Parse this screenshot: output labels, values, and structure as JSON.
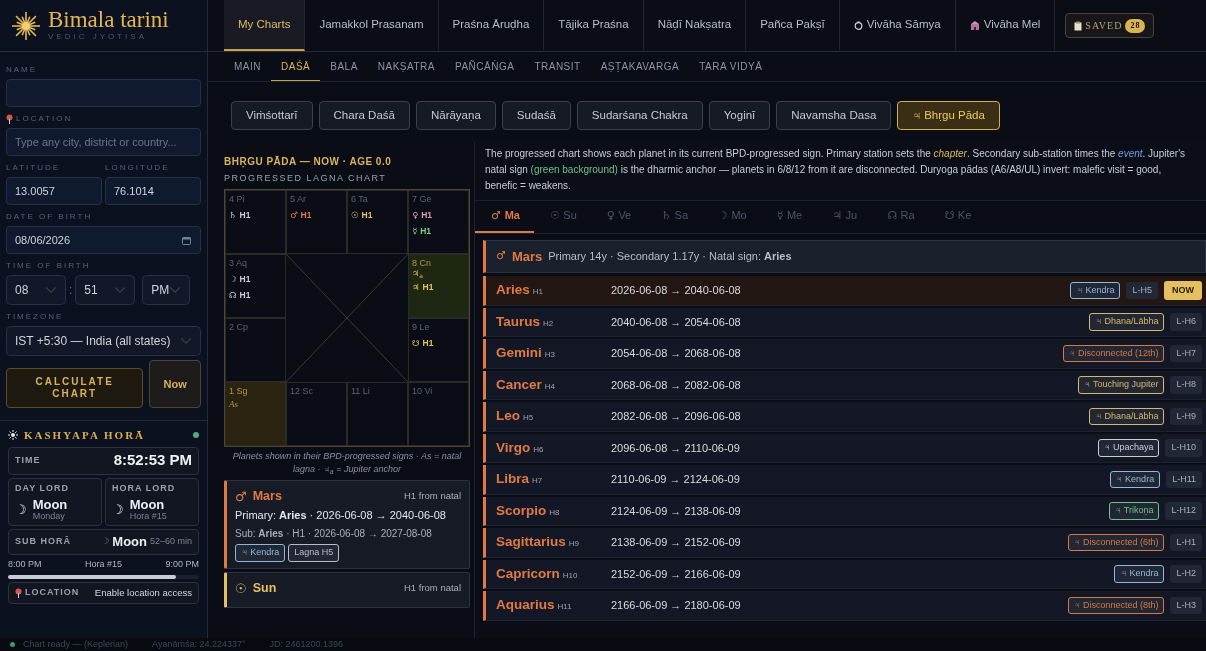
{
  "brand": {
    "name": "Bimala tarini",
    "tagline": "VEDIC JYOTISA"
  },
  "form": {
    "name": {
      "label": "NAME"
    },
    "location": {
      "label": "LOCATION",
      "placeholder": "Type any city, district or country..."
    },
    "latitude": {
      "label": "LATITUDE",
      "value": "13.0057"
    },
    "longitude": {
      "label": "LONGITUDE",
      "value": "76.1014"
    },
    "dob": {
      "label": "DATE OF BIRTH",
      "value": "08/06/2026"
    },
    "tob": {
      "label": "TIME OF BIRTH",
      "hour": "08",
      "separator": ":",
      "minute": "51",
      "ampm": "PM"
    },
    "timezone": {
      "label": "TIMEZONE",
      "value": "IST +5:30 — India (all states)"
    },
    "calculate_button": "CALCULATE CHART",
    "now_button": "Now"
  },
  "hora": {
    "title": "KASHYAPA HORĀ",
    "live": true,
    "time_label": "TIME",
    "time": "8:52:53 PM",
    "day_lord": {
      "label": "DAY LORD",
      "glyph": "☽",
      "name": "Moon",
      "sub": "Monday"
    },
    "hora_lord": {
      "label": "HORA LORD",
      "glyph": "☽",
      "name": "Moon",
      "sub": "Hora #15"
    },
    "sub_hora": {
      "label": "SUB HORĀ",
      "glyph": "☽",
      "name": "Moon",
      "range": "52–60 min"
    },
    "progress": {
      "start": "8:00 PM",
      "label": "Hora #15",
      "end": "9:00 PM",
      "level": 0.88
    },
    "location": {
      "label": "LOCATION",
      "action": "Enable location access"
    }
  },
  "top_nav": [
    {
      "label": "My Charts",
      "kind": "plain",
      "selected": true
    },
    {
      "label": "Jamakkol Prasanam",
      "kind": "plain",
      "selected": false
    },
    {
      "label": "Praśna Āruḍha",
      "kind": "plain",
      "selected": false
    },
    {
      "label": "Tājika Praśna",
      "kind": "plain",
      "selected": false
    },
    {
      "label": "Nāḍī Nakṣatra",
      "kind": "plain",
      "selected": false
    },
    {
      "label": "Pañca Pakṣī",
      "kind": "plain",
      "selected": false
    },
    {
      "label": "Vivāha Sāmya",
      "kind": "ring",
      "selected": false
    },
    {
      "label": "Vivāha Mel",
      "kind": "building",
      "selected": false
    }
  ],
  "saved": {
    "label": "SAVED",
    "count": "28"
  },
  "sub_nav": [
    {
      "label": "MAIN",
      "selected": false
    },
    {
      "label": "DAŚĀ",
      "selected": true
    },
    {
      "label": "BALA",
      "selected": false
    },
    {
      "label": "NAKṢATRA",
      "selected": false
    },
    {
      "label": "PAÑCĀṄGA",
      "selected": false
    },
    {
      "label": "TRANSIT",
      "selected": false
    },
    {
      "label": "AṢṬAKAVARGA",
      "selected": false
    },
    {
      "label": "TARA VIDYĀ",
      "selected": false
    }
  ],
  "dasha_systems": [
    {
      "label": "Viṁśottarī",
      "selected": false
    },
    {
      "label": "Chara Daśā",
      "selected": false
    },
    {
      "label": "Nārāyaṇa",
      "selected": false
    },
    {
      "label": "Sudaśā",
      "selected": false
    },
    {
      "label": "Sudarśana Chakra",
      "selected": false
    },
    {
      "label": "Yoginī",
      "selected": false
    },
    {
      "label": "Navamsha Dasa",
      "selected": false
    },
    {
      "label": "♃ Bhṛgu Pāda",
      "selected": true
    }
  ],
  "chart": {
    "heading": "BHṚGU PĀDA — NOW · AGE 0.0",
    "subheading": "PROGRESSED LAGNA CHART",
    "cells": [
      {
        "label": "4 Pi",
        "kind": "house",
        "planets": [
          {
            "glyph": "♄",
            "text": "H1",
            "color": "#c9ccd6"
          }
        ]
      },
      {
        "label": "5 Ar",
        "kind": "house",
        "planets": [
          {
            "glyph": "♂",
            "text": "H1",
            "color": "#e07a45"
          }
        ]
      },
      {
        "label": "6 Ta",
        "kind": "house",
        "planets": [
          {
            "glyph": "☉",
            "text": "H1",
            "color": "#e3c062"
          }
        ]
      },
      {
        "label": "7 Ge",
        "kind": "house",
        "planets": [
          {
            "glyph": "♀",
            "text": "H1",
            "color": "#e49ab0"
          },
          {
            "glyph": "☿",
            "text": "H1",
            "color": "#7fcf8f"
          }
        ]
      },
      {
        "label": "3 Aq",
        "kind": "house",
        "planets": [
          {
            "glyph": "☽",
            "text": "H1",
            "color": "#c9ccd6"
          },
          {
            "glyph": "☊",
            "text": "H1",
            "color": "#c9ccd6"
          }
        ]
      },
      {
        "label": "8 Cn",
        "kind": "anchor",
        "anchor_mark": "♃$_{a}$",
        "planets": [
          {
            "glyph": "♃",
            "text": "H1",
            "color": "#e3c062"
          }
        ]
      },
      {
        "label": "2 Cp",
        "kind": "house"
      },
      {
        "label": "9 Le",
        "kind": "house",
        "planets": [
          {
            "glyph": "☋",
            "text": "H1",
            "color": "#e3c062"
          }
        ]
      },
      {
        "label": "1 Sg",
        "kind": "lagna",
        "note": "As"
      },
      {
        "label": "12 Sc",
        "kind": "house"
      },
      {
        "label": "11 Li",
        "kind": "house"
      },
      {
        "label": "10 Vi",
        "kind": "house"
      }
    ],
    "footnote": "Planets shown in their BPD-progressed signs · As = natal lagna · ♃$_{a}$ = Jupiter anchor"
  },
  "planet_cards": [
    {
      "glyph": "♂",
      "name": "Mars",
      "color": "#e07a45",
      "position": "H1 from natal",
      "primary": "Primary: **Aries** · 2026-06-08 → 2040-06-08",
      "sub": "Sub: **Aries** · H1 · 2026-06-08 → 2027-08-08",
      "tags": [
        {
          "text": "♃ Kendra",
          "color": "#8fb8dc"
        },
        {
          "text": "Lagna H5",
          "color": "#b9bdc8"
        }
      ]
    },
    {
      "glyph": "☉",
      "name": "Sun",
      "color": "#e3c062",
      "position": "H1 from natal"
    }
  ],
  "description": [
    {
      "kind": "plain",
      "text": "The progressed chart shows each planet in its current BPD-progressed sign. Primary station sets the "
    },
    {
      "kind": "chapter",
      "text": "chapter"
    },
    {
      "kind": "plain",
      "text": ". Secondary sub-station times the "
    },
    {
      "kind": "event",
      "text": "event"
    },
    {
      "kind": "plain",
      "text": ". Jupiter's natal sign "
    },
    {
      "kind": "green",
      "text": "(green background)"
    },
    {
      "kind": "plain",
      "text": " is the dharmic anchor — planets in 6/8/12 from it are disconnected. Duryoga pādas (A6/A8/UL) invert: malefic visit = good, benefic = weakens."
    }
  ],
  "planet_tabs": [
    {
      "glyph": "♂",
      "label": "Ma",
      "selected": true
    },
    {
      "glyph": "☉",
      "label": "Su",
      "selected": false
    },
    {
      "glyph": "♀",
      "label": "Ve",
      "selected": false
    },
    {
      "glyph": "♄",
      "label": "Sa",
      "selected": false
    },
    {
      "glyph": "☽",
      "label": "Mo",
      "selected": false
    },
    {
      "glyph": "☿",
      "label": "Me",
      "selected": false
    },
    {
      "glyph": "♃",
      "label": "Ju",
      "selected": false
    },
    {
      "glyph": "☊",
      "label": "Ra",
      "selected": false
    },
    {
      "glyph": "☋",
      "label": "Ke",
      "selected": false
    }
  ],
  "dasha": {
    "glyph": "♂",
    "name": "Mars",
    "color": "#e07a45",
    "summary": "Primary 14y · Secondary 1.17y · Natal sign: **Aries**",
    "rows": [
      {
        "sign": "Aries",
        "house": "H1",
        "range": "2026-06-08 → 2040-06-08",
        "tag": {
          "text": "♃ Kendra",
          "color": "#8fb8dc"
        },
        "lord": "L-H5",
        "current": true,
        "badge": "NOW"
      },
      {
        "sign": "Taurus",
        "house": "H2",
        "range": "2040-06-08 → 2054-06-08",
        "tag": {
          "text": "♃ Dhana/Lābha",
          "color": "#d8b860"
        },
        "lord": "L-H6",
        "current": false
      },
      {
        "sign": "Gemini",
        "house": "H3",
        "range": "2054-06-08 → 2068-06-08",
        "tag": {
          "text": "♃ Disconnected (12th)",
          "color": "#d9773f"
        },
        "lord": "L-H7",
        "current": false
      },
      {
        "sign": "Cancer",
        "house": "H4",
        "range": "2068-06-08 → 2082-06-08",
        "tag": {
          "text": "♃ Touching Jupiter",
          "color": "#d8b860"
        },
        "lord": "L-H8",
        "current": false
      },
      {
        "sign": "Leo",
        "house": "H5",
        "range": "2082-06-08 → 2096-06-08",
        "tag": {
          "text": "♃ Dhana/Lābha",
          "color": "#d8b860"
        },
        "lord": "L-H9",
        "current": false
      },
      {
        "sign": "Virgo",
        "house": "H6",
        "range": "2096-06-08 → 2110-06-09",
        "tag": {
          "text": "♃ Upachaya",
          "color": "#c9cdd8"
        },
        "lord": "L-H10",
        "current": false
      },
      {
        "sign": "Libra",
        "house": "H7",
        "range": "2110-06-09 → 2124-06-09",
        "tag": {
          "text": "♃ Kendra",
          "color": "#8fb8dc"
        },
        "lord": "L-H11",
        "current": false
      },
      {
        "sign": "Scorpio",
        "house": "H8",
        "range": "2124-06-09 → 2138-06-09",
        "tag": {
          "text": "♃ Trikoṇa",
          "color": "#6fbf8a"
        },
        "lord": "L-H12",
        "current": false
      },
      {
        "sign": "Sagittarius",
        "house": "H9",
        "range": "2138-06-09 → 2152-06-09",
        "tag": {
          "text": "♃ Disconnected (6th)",
          "color": "#d9773f"
        },
        "lord": "L-H1",
        "current": false
      },
      {
        "sign": "Capricorn",
        "house": "H10",
        "range": "2152-06-09 → 2166-06-09",
        "tag": {
          "text": "♃ Kendra",
          "color": "#8fb8dc"
        },
        "lord": "L-H2",
        "current": false
      },
      {
        "sign": "Aquarius",
        "house": "H11",
        "range": "2166-06-09 → 2180-06-09",
        "tag": {
          "text": "♃ Disconnected (8th)",
          "color": "#d9773f"
        },
        "lord": "L-H3",
        "current": false
      }
    ]
  },
  "status_bar": {
    "ready": true,
    "text": "Chart ready — (Keplerian)",
    "ayanamsa": "Ayanāṁśa: 24.224337°",
    "jd": "JD: 2461200.1396"
  }
}
